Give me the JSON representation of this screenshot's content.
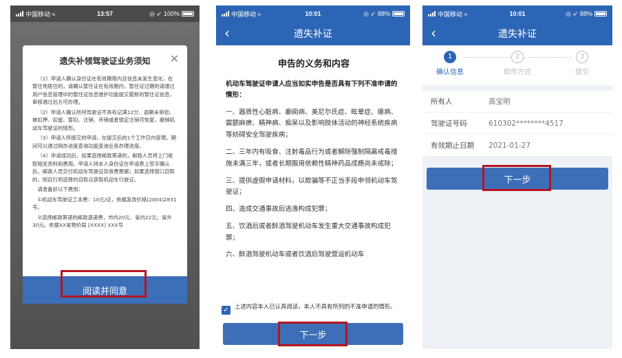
{
  "phone1": {
    "status": {
      "carrier": "中国移动",
      "time": "13:57",
      "battery": "100%"
    },
    "modal": {
      "title": "遗失补领驾驶证业务须知",
      "close_icon": "close-icon",
      "paragraphs": [
        "（1）申请人确认身份证在有效期限内且信息未发生变化，在暂住地居住的，请确认暂住证在有效期内，暂住证过期的请通过用户信息管理中的暂住证信息维护功能提交最新的暂住证信息，审核通过后方可办理。",
        "（2）申请人确认所持驾驶证不具有记满12分、逾期未审验、被扣押、扣留、暂扣、注销、吊销或者锁定注销可恢复，撤销机动车驾驶证的情形。",
        "（3）申请人所提交的申请，在提交后的1个工作日内受理。期间可以通过网办进度查询功能查询业务办理进度。",
        "（4）申请成功后，如果选择邮政寄递的，邮政人员将上门收取相关资料和费用。申请人持本人身份证在申请表上签字确认后，邮政人员交付机动车驾驶证及收费票据；如果选择窗口自取的，则自行到选择的自取点获取机动车行驶证。",
        "请准备好以下费用：",
        "①机动车驾驶证工本费：10元/证，依据发改价格[2004]2831号。",
        "②选择邮政寄递的邮政速递费，市内20元、省内22元、省外30元。依据XX省物价局 [XXXX] XXX号"
      ],
      "confirm_label": "阅读并同意"
    }
  },
  "phone2": {
    "status": {
      "carrier": "中国移动",
      "time": "10:01",
      "battery": "88%"
    },
    "nav_title": "遗失补证",
    "doc": {
      "title": "申告的义务和内容",
      "intro": "机动车驾驶证申请人应当如实申告是否具有下列不准申请的情形：",
      "items": [
        "一、器质性心脏病、癫痫病、美尼尔氏症、眩晕症、癔病、震颤麻痹、精神病、痴呆以及影响肢体活动的神经系统疾病等妨碍安全驾驶疾病；",
        "二、三年内有吸食、注射毒品行为或者解除强制隔离戒毒措施未满三年，或者长期服用依赖性精神药品成瘾尚未戒除；",
        "三、提供虚假申请材料，以欺骗等不正当手段申领机动车驾驶证；",
        "四、造成交通事故后逃逸构成犯罪；",
        "五、饮酒后或者醉酒驾驶机动车发生重大交通事故构成犯罪；",
        "六、醉酒驾驶机动车或者饮酒后驾驶营运机动车"
      ]
    },
    "agree_text": "上述内容本人已认真阅读，本人不具有所列的不准申请的情形。",
    "next_label": "下一步"
  },
  "phone3": {
    "status": {
      "carrier": "中国移动",
      "time": "10:01",
      "battery": "88%"
    },
    "nav_title": "遗失补证",
    "steps": [
      {
        "num": "1",
        "label": "确认信息"
      },
      {
        "num": "2",
        "label": "取件方式"
      },
      {
        "num": "3",
        "label": "提交"
      }
    ],
    "info": [
      {
        "key": "所有人",
        "value": "高宝明"
      },
      {
        "key": "驾驶证号码",
        "value": "610302********4517"
      },
      {
        "key": "有效期止日期",
        "value": "2021-01-27"
      }
    ],
    "next_label": "下一步"
  },
  "colors": {
    "primary": "#2c65b5",
    "button": "#3d6eb8",
    "highlight": "#b8141e"
  }
}
